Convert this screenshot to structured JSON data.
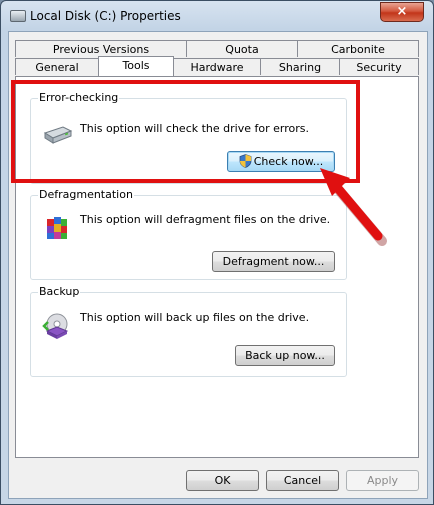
{
  "window": {
    "title": "Local Disk (C:) Properties",
    "close_glyph": "×"
  },
  "tabs_row_top": [
    "Previous Versions",
    "Quota",
    "Carbonite"
  ],
  "tabs_row_bottom": [
    "General",
    "Tools",
    "Hardware",
    "Sharing",
    "Security"
  ],
  "selected_tab": "Tools",
  "groups": {
    "error_checking": {
      "title": "Error-checking",
      "text": "This option will check the drive for errors.",
      "button": "Check now...",
      "icon": "hard-drive-icon"
    },
    "defragmentation": {
      "title": "Defragmentation",
      "text": "This option will defragment files on the drive.",
      "button": "Defragment now...",
      "icon": "defragment-icon"
    },
    "backup": {
      "title": "Backup",
      "text": "This option will back up files on the drive.",
      "button": "Back up now...",
      "icon": "backup-icon"
    }
  },
  "footer": {
    "ok": "OK",
    "cancel": "Cancel",
    "apply": "Apply"
  },
  "colors": {
    "annotation_red": "#e01010",
    "close_button": "#c2351a"
  }
}
